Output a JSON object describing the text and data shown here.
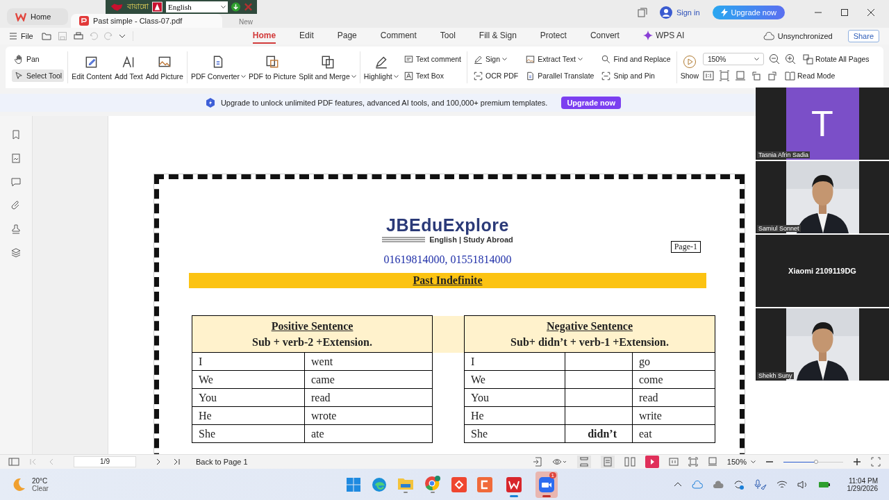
{
  "title_bar": {
    "tabs": [
      {
        "label": "Home",
        "selected": false
      },
      {
        "label": "Past simple - Class-07.pdf",
        "selected": true
      }
    ],
    "new_tab": "New",
    "sign_in": "Sign in",
    "upgrade": "Upgrade now"
  },
  "keyboard_tool": {
    "name": "বায়ান্নো",
    "language": "English"
  },
  "menu": {
    "file": "File",
    "tabs": [
      {
        "label": "Home",
        "selected": true
      },
      {
        "label": "Edit",
        "selected": false
      },
      {
        "label": "Page",
        "selected": false
      },
      {
        "label": "Comment",
        "selected": false
      },
      {
        "label": "Tool",
        "selected": false
      },
      {
        "label": "Fill & Sign",
        "selected": false
      },
      {
        "label": "Protect",
        "selected": false
      },
      {
        "label": "Convert",
        "selected": false
      },
      {
        "label": "WPS AI",
        "selected": false
      }
    ],
    "sync": "Unsynchronized",
    "share": "Share"
  },
  "ribbon": {
    "groups": [
      {
        "columns": [
          {
            "kind": "stack",
            "items": [
              {
                "label": "Pan",
                "selected": false
              },
              {
                "label": "Select Tool",
                "selected": true
              }
            ]
          }
        ]
      },
      {
        "columns": [
          {
            "kind": "large",
            "items": [
              {
                "label": "Edit Content"
              }
            ]
          },
          {
            "kind": "large",
            "items": [
              {
                "label": "Add Text"
              }
            ]
          },
          {
            "kind": "large",
            "items": [
              {
                "label": "Add Picture"
              }
            ]
          }
        ]
      },
      {
        "columns": [
          {
            "kind": "large",
            "items": [
              {
                "label": "PDF Converter",
                "dropdown": true
              }
            ]
          },
          {
            "kind": "large",
            "items": [
              {
                "label": "PDF to Picture"
              }
            ]
          },
          {
            "kind": "large",
            "items": [
              {
                "label": "Split and Merge",
                "dropdown": true
              }
            ]
          }
        ]
      },
      {
        "columns": [
          {
            "kind": "large",
            "items": [
              {
                "label": "Highlight",
                "dropdown": true
              }
            ]
          },
          {
            "kind": "stack",
            "items": [
              {
                "label": "Text comment"
              },
              {
                "label": "Text Box"
              }
            ]
          }
        ]
      },
      {
        "columns": [
          {
            "kind": "stack",
            "items": [
              {
                "label": "Sign",
                "dropdown": true
              },
              {
                "label": "OCR PDF"
              }
            ]
          },
          {
            "kind": "stack",
            "items": [
              {
                "label": "Extract Text",
                "dropdown": true
              },
              {
                "label": "Parallel Translate"
              }
            ]
          },
          {
            "kind": "stack",
            "items": [
              {
                "label": "Find and Replace"
              },
              {
                "label": "Snip and Pin"
              }
            ]
          }
        ]
      }
    ],
    "view": {
      "show": "Show",
      "zoom": "150%",
      "rotate": "Rotate All Pages",
      "read_mode": "Read Mode"
    }
  },
  "banner": {
    "text": "Upgrade to unlock unlimited PDF features, advanced AI tools, and 100,000+ premium templates.",
    "button": "Upgrade now"
  },
  "document": {
    "logo": "JBEduExplore",
    "tagline": "English | Study Abroad",
    "phone": "01619814000, 01551814000",
    "page_label": "Page-1",
    "title": "Past Indefinite",
    "positive": {
      "title": "Positive Sentence",
      "formula": "Sub + verb-2 +Extension.",
      "rows": [
        {
          "subject": "I",
          "verb": "went"
        },
        {
          "subject": "We",
          "verb": "came"
        },
        {
          "subject": "You",
          "verb": "read"
        },
        {
          "subject": "He",
          "verb": "wrote"
        },
        {
          "subject": "She",
          "verb": "ate"
        }
      ]
    },
    "negative": {
      "title": "Negative Sentence",
      "formula": "Sub+ didn’t + verb-1 +Extension.",
      "rows": [
        {
          "subject": "I",
          "verb": "go"
        },
        {
          "subject": "We",
          "verb": "come"
        },
        {
          "subject": "You",
          "verb": "read"
        },
        {
          "subject": "He",
          "verb": "write"
        },
        {
          "subject": "She",
          "aux": "didn’t",
          "verb": "eat"
        }
      ]
    }
  },
  "participants": [
    {
      "kind": "avatar",
      "initial": "T",
      "name": "Tasnia Afrin Sadia"
    },
    {
      "kind": "video",
      "name": "Samiul Sonnet"
    },
    {
      "kind": "device",
      "name": "Xiaomi 2109119DG"
    },
    {
      "kind": "video",
      "name": "Shekh Suny"
    }
  ],
  "status_bar": {
    "page": "1/9",
    "back": "Back to Page 1",
    "zoom": "150%",
    "zoom_slider": {
      "level": 0.55
    }
  },
  "taskbar": {
    "weather": {
      "temp": "20°C",
      "condition": "Clear"
    },
    "zoom_badge": "1",
    "time": "11:04 PM",
    "date": "1/29/2026"
  }
}
